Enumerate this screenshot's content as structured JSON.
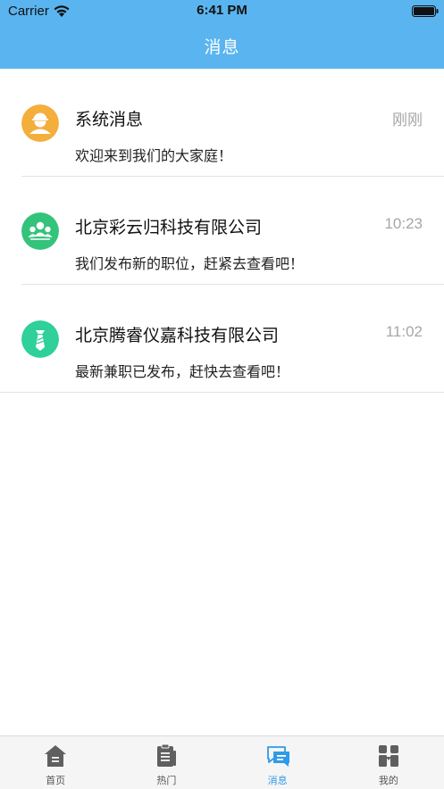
{
  "status_bar": {
    "carrier": "Carrier",
    "time": "6:41 PM",
    "wifi_icon": "wifi-icon",
    "battery_icon": "battery-icon"
  },
  "nav": {
    "title": "消息",
    "background_color": "#5ab4ef"
  },
  "messages": [
    {
      "title": "系统消息",
      "time": "刚刚",
      "body": "欢迎来到我们的大家庭！",
      "avatar_icon": "worker-avatar-icon",
      "avatar_color": "#f3ae3c"
    },
    {
      "title": "北京彩云归科技有限公司",
      "time": "10:23",
      "body": "我们发布新的职位，赶紧去查看吧！",
      "avatar_icon": "group-avatar-icon",
      "avatar_color": "#33c37b"
    },
    {
      "title": "北京腾睿仪嘉科技有限公司",
      "time": "11:02",
      "body": "最新兼职已发布，赶快去查看吧！",
      "avatar_icon": "tie-avatar-icon",
      "avatar_color": "#2fd09a"
    }
  ],
  "tabs": [
    {
      "label": "首页",
      "icon": "home-icon",
      "active": false
    },
    {
      "label": "热门",
      "icon": "clipboard-icon",
      "active": false
    },
    {
      "label": "消息",
      "icon": "message-icon",
      "active": true
    },
    {
      "label": "我的",
      "icon": "profile-icon",
      "active": false
    }
  ],
  "colors": {
    "accent": "#2f9be8",
    "inactive_tab": "#5f5f5f"
  }
}
